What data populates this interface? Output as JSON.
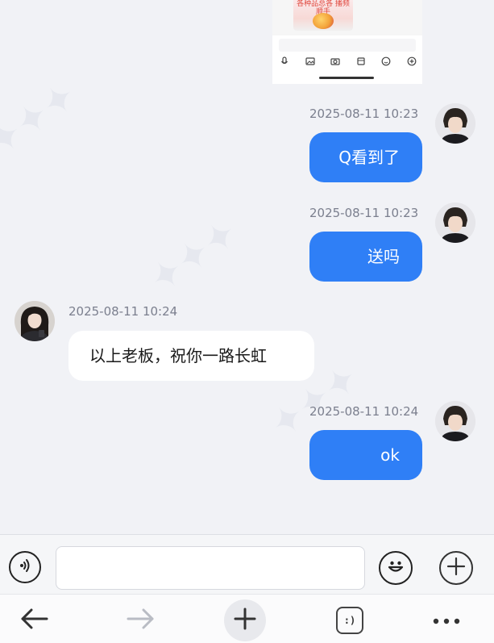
{
  "top_image": {
    "caption_text": "各种品总各 播频顺手"
  },
  "messages": [
    {
      "side": "out",
      "timestamp": "2025-08-11 10:23",
      "text": "Q看到了"
    },
    {
      "side": "out",
      "timestamp": "2025-08-11 10:23",
      "text": "送吗"
    },
    {
      "side": "in",
      "timestamp": "2025-08-11 10:24",
      "text": "以上老板，祝你一路长虹"
    },
    {
      "side": "out",
      "timestamp": "2025-08-11 10:24",
      "text": "ok"
    }
  ],
  "input_bar": {
    "voice_icon": "voice-icon",
    "input_value": "",
    "emoji_icon": "emoji-icon",
    "plus_icon": "plus-icon"
  },
  "browser_bar": {
    "tabs_label": ":)",
    "icons": [
      "back-arrow-icon",
      "forward-arrow-icon",
      "new-tab-plus-icon",
      "tabs-icon",
      "more-icon"
    ]
  },
  "colors": {
    "background": "#f1f2f6",
    "outgoing_bubble": "#2f7ff6",
    "incoming_bubble": "#ffffff",
    "timestamp": "#7b7f8e"
  }
}
